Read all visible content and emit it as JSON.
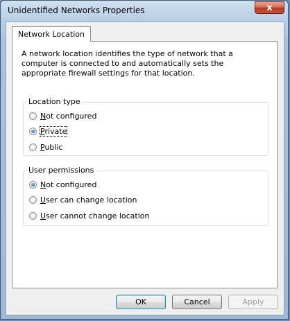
{
  "window": {
    "title": "Unidentified Networks Properties",
    "close_glyph": "x"
  },
  "tabs": [
    {
      "label": "Network Location",
      "selected": true
    }
  ],
  "description": "A network location identifies the type of network that a computer is connected to and automatically sets the appropriate firewall settings for that location.",
  "location_type": {
    "legend": "Location type",
    "options": [
      {
        "mnemonic": "N",
        "rest": "ot configured",
        "checked": false
      },
      {
        "mnemonic": "P",
        "rest": "rivate",
        "checked": true,
        "focused": true
      },
      {
        "mnemonic": "P",
        "rest": "ublic",
        "checked": false
      }
    ]
  },
  "user_permissions": {
    "legend": "User permissions",
    "options": [
      {
        "mnemonic": "N",
        "rest": "ot configured",
        "checked": true
      },
      {
        "mnemonic": "U",
        "rest": "ser can change location",
        "checked": false
      },
      {
        "mnemonic": "U",
        "rest": "ser cannot change location",
        "checked": false
      }
    ]
  },
  "buttons": {
    "ok": "OK",
    "cancel": "Cancel",
    "apply": "Apply"
  }
}
